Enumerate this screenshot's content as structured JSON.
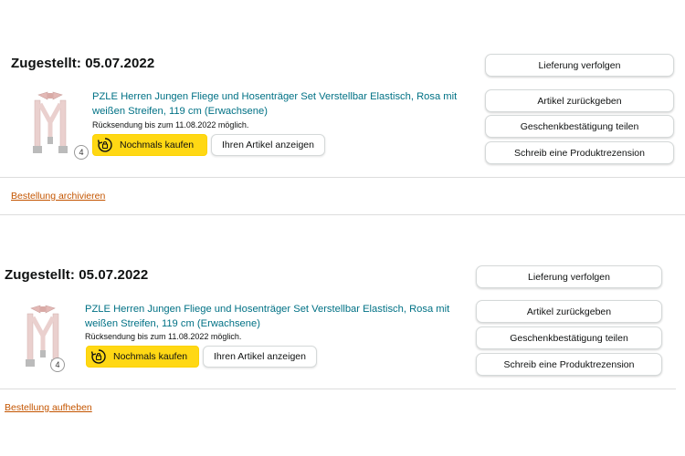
{
  "orders": [
    {
      "status": "Zugestellt: 05.07.2022",
      "product_title": "PZLE Herren Jungen Fliege und Hosenträger Set Verstellbar Elastisch, Rosa mit weißen Streifen, 119 cm (Erwachsene)",
      "return_note": "Rücksendung bis zum 11.08.2022 möglich.",
      "quantity": "4",
      "buy_again_label": "Nochmals kaufen",
      "view_item_label": "Ihren Artikel anzeigen",
      "actions": [
        "Lieferung verfolgen",
        "Artikel zurückgeben",
        "Geschenkbestätigung teilen",
        "Schreib eine Produktrezension"
      ],
      "footer_link": "Bestellung archivieren"
    },
    {
      "status": "Zugestellt: 05.07.2022",
      "product_title": "PZLE Herren Jungen Fliege und Hosenträger Set Verstellbar Elastisch, Rosa mit weißen Streifen, 119 cm (Erwachsene)",
      "return_note": "Rücksendung bis zum 11.08.2022 möglich.",
      "quantity": "4",
      "buy_again_label": "Nochmals kaufen",
      "view_item_label": "Ihren Artikel anzeigen",
      "actions": [
        "Lieferung verfolgen",
        "Artikel zurückgeben",
        "Geschenkbestätigung teilen",
        "Schreib eine Produktrezension"
      ],
      "footer_link": "Bestellung aufheben"
    }
  ],
  "colors": {
    "link": "#007185",
    "footer_link": "#c45500",
    "buy_button": "#ffd814",
    "product_pink": "#e8c8c6"
  },
  "icons": {
    "buy_again": "buy-again-icon",
    "product": "suspenders-bowtie-product-image"
  }
}
